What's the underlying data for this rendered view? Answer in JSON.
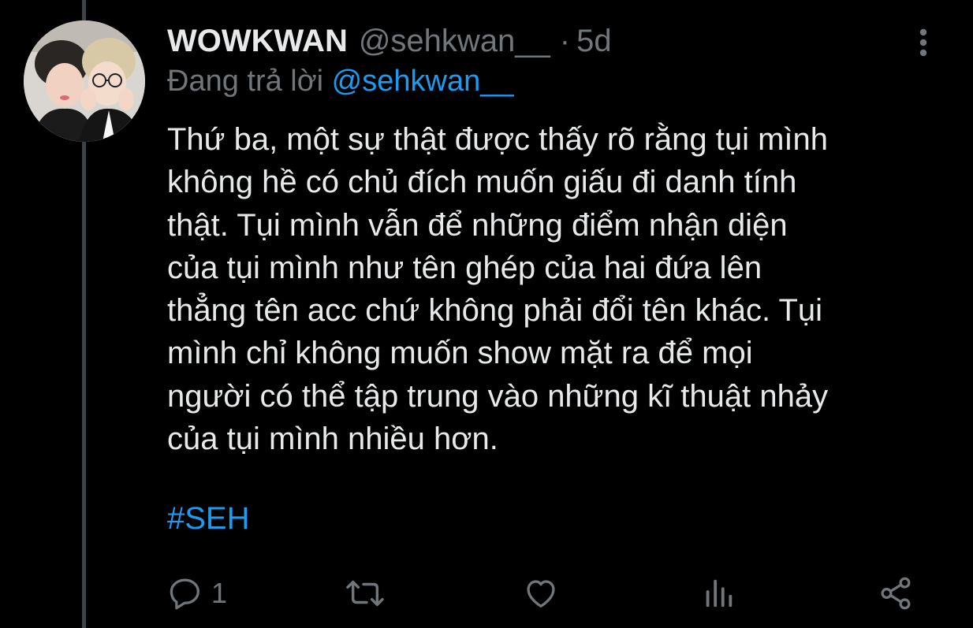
{
  "tweet": {
    "display_name": "WOWKWAN",
    "handle": "@sehkwan__",
    "separator": "·",
    "time": "5d",
    "reply_prefix": "Đang trả lời",
    "reply_to": "@sehkwan__",
    "body": "Thứ ba, một sự thật được thấy rõ rằng tụi mình\nkhông hề có chủ đích muốn giấu đi danh tính\nthật. Tụi mình vẫn để những điểm nhận diện\ncủa tụi mình như tên ghép của hai đứa lên\nthẳng tên acc chứ không phải đổi tên khác. Tụi\nmình chỉ không muốn show mặt ra để mọi\nngười có thể tập trung vào những kĩ thuật nhảy\ncủa tụi mình nhiều hơn.",
    "hashtag": "#SEH"
  },
  "actions": {
    "reply_count": "1",
    "icons": [
      "reply-icon",
      "retweet-icon",
      "like-icon",
      "analytics-icon",
      "share-icon"
    ]
  },
  "colors": {
    "background": "#000000",
    "text": "#e7e9ea",
    "muted": "#71767b",
    "accent": "#1d9bf0",
    "thread_line": "#3d4348"
  }
}
